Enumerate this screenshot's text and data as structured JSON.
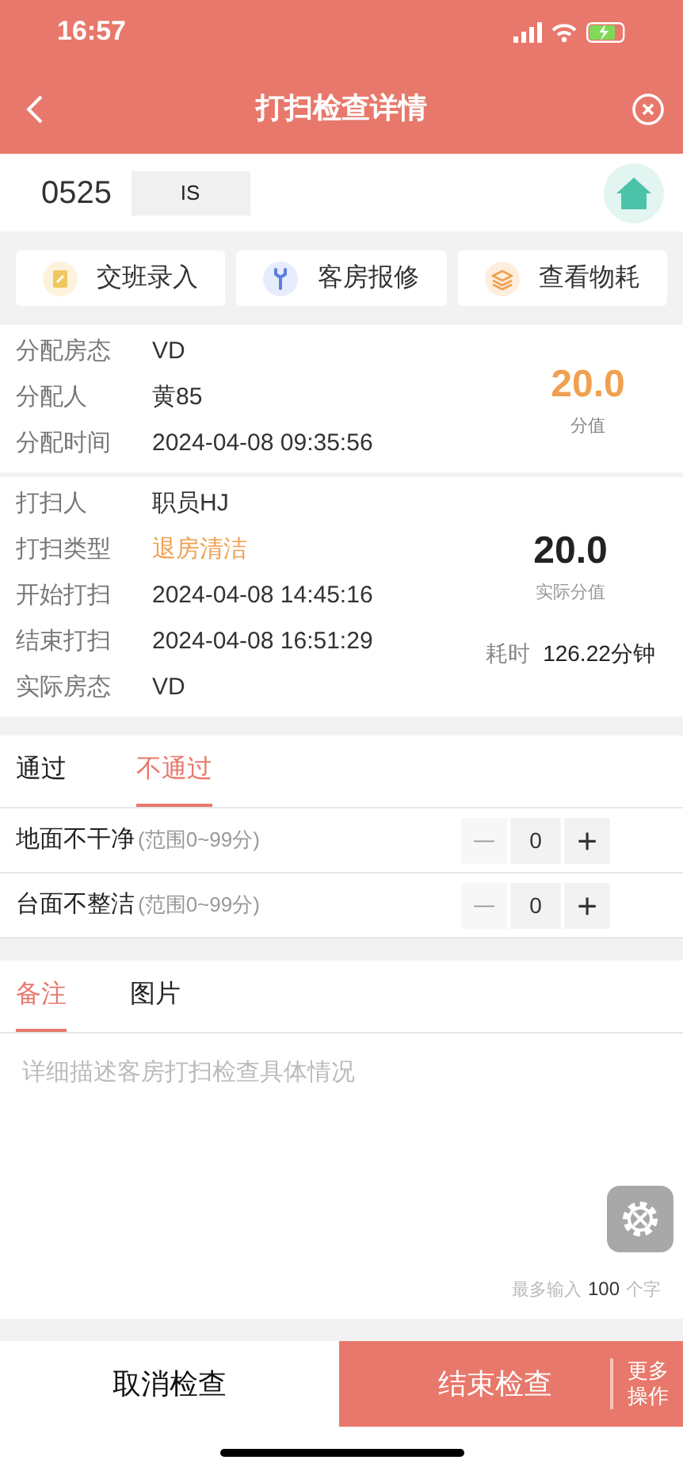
{
  "status_bar": {
    "time": "16:57"
  },
  "header": {
    "title": "打扫检查详情"
  },
  "room": {
    "number": "0525",
    "status": "IS"
  },
  "actions": [
    {
      "kind": "clipboard",
      "label": "交班录入"
    },
    {
      "kind": "wrench",
      "label": "客房报修"
    },
    {
      "kind": "layers",
      "label": "查看物耗"
    }
  ],
  "assignment": {
    "fields": [
      {
        "label": "分配房态",
        "value": "VD",
        "kind": "plain"
      },
      {
        "label": "分配人",
        "value": "黄85",
        "kind": "plain"
      },
      {
        "label": "分配时间",
        "value": "2024-04-08 09:35:56",
        "kind": "plain"
      }
    ],
    "score": "20.0",
    "score_label": "分值"
  },
  "cleaning": {
    "fields": [
      {
        "label": "打扫人",
        "value": "职员HJ",
        "kind": "plain"
      },
      {
        "label": "打扫类型",
        "value": "退房清洁",
        "kind": "accent"
      },
      {
        "label": "开始打扫",
        "value": "2024-04-08 14:45:16",
        "kind": "plain"
      },
      {
        "label": "结束打扫",
        "value": "2024-04-08 16:51:29",
        "kind": "plain"
      },
      {
        "label": "实际房态",
        "value": "VD",
        "kind": "plain"
      }
    ],
    "score": "20.0",
    "score_label": "实际分值",
    "duration_label": "耗时",
    "duration": "126.22分钟"
  },
  "result_tabs": [
    {
      "label": "通过",
      "selected": false
    },
    {
      "label": "不通过",
      "selected": true
    }
  ],
  "deductions": [
    {
      "label": "地面不干净",
      "range": "(范围0~99分)",
      "minus": "—",
      "value": "0",
      "plus": "+"
    },
    {
      "label": "台面不整洁",
      "range": "(范围0~99分)",
      "minus": "—",
      "value": "0",
      "plus": "+"
    }
  ],
  "note_tabs": [
    {
      "label": "备注",
      "selected": true
    },
    {
      "label": "图片",
      "selected": false
    }
  ],
  "note": {
    "placeholder": "详细描述客房打扫检查具体情况",
    "limit_prefix": "最多输入",
    "limit": "100",
    "limit_suffix": "个字"
  },
  "footer": {
    "cancel": "取消检查",
    "finish": "结束检查",
    "more": "更多操作"
  }
}
